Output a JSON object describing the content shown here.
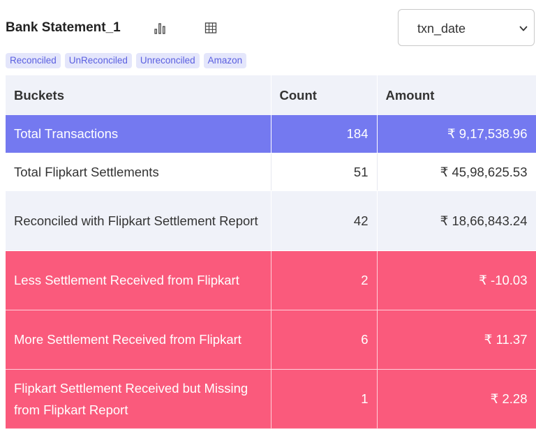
{
  "header": {
    "title": "Bank Statement_1",
    "chart_icon": "bar-chart-icon",
    "table_icon": "table-grid-icon",
    "date_select": {
      "value": "txn_date",
      "icon": "chevron-down-icon"
    }
  },
  "tags": [
    "Reconciled",
    "UnReconciled",
    "Unreconciled",
    "Amazon"
  ],
  "table": {
    "columns": [
      "Buckets",
      "Count",
      "Amount"
    ],
    "rows": [
      {
        "bucket": "Total Transactions",
        "count": "184",
        "amount": "₹ 9,17,538.96",
        "style": "blue"
      },
      {
        "bucket": "Total Flipkart Settlements",
        "count": "51",
        "amount": "₹ 45,98,625.53",
        "style": "white"
      },
      {
        "bucket": "Reconciled with Flipkart Settlement Report",
        "count": "42",
        "amount": "₹ 18,66,843.24",
        "style": "grey"
      },
      {
        "bucket": "Less Settlement Received from Flipkart",
        "count": "2",
        "amount": "₹ -10.03",
        "style": "red"
      },
      {
        "bucket": "More Settlement Received from Flipkart",
        "count": "6",
        "amount": "₹ 11.37",
        "style": "red"
      },
      {
        "bucket": "Flipkart Settlement Received but Missing from Flipkart Report",
        "count": "1",
        "amount": "₹ 2.28",
        "style": "red"
      }
    ]
  },
  "colors": {
    "accent_blue": "#7479f0",
    "alert_red": "#fa5a7c",
    "header_bg": "#f0f2f9",
    "tag_bg": "#e4e6fb",
    "tag_text": "#5a5fe0"
  }
}
